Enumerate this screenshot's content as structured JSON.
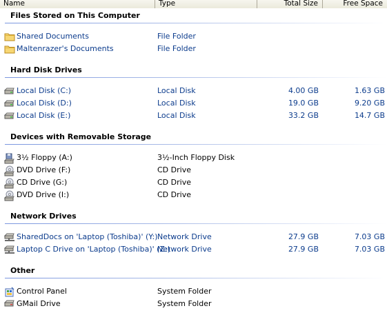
{
  "columns": {
    "name": "Name",
    "type": "Type",
    "total_size": "Total Size",
    "free_space": "Free Space"
  },
  "groups": {
    "files_stored": "Files Stored on This Computer",
    "hard_disks": "Hard Disk Drives",
    "removable": "Devices with Removable Storage",
    "network": "Network Drives",
    "other": "Other"
  },
  "files_stored": [
    {
      "name": "Shared Documents",
      "type": "File Folder",
      "icon": "folder-icon"
    },
    {
      "name": "Maltenrazer's Documents",
      "type": "File Folder",
      "icon": "folder-icon"
    }
  ],
  "hard_disks": [
    {
      "name": "Local Disk (C:)",
      "type": "Local Disk",
      "total": "4.00 GB",
      "free": "1.63 GB",
      "icon": "hard-disk-icon"
    },
    {
      "name": "Local Disk (D:)",
      "type": "Local Disk",
      "total": "19.0 GB",
      "free": "9.20 GB",
      "icon": "hard-disk-icon"
    },
    {
      "name": "Local Disk (E:)",
      "type": "Local Disk",
      "total": "33.2 GB",
      "free": "14.7 GB",
      "icon": "hard-disk-icon"
    }
  ],
  "removable": [
    {
      "name": "3½ Floppy (A:)",
      "type": "3½-Inch Floppy Disk",
      "icon": "floppy-drive-icon"
    },
    {
      "name": "DVD Drive (F:)",
      "type": "CD Drive",
      "icon": "dvd-drive-icon"
    },
    {
      "name": "CD Drive (G:)",
      "type": "CD Drive",
      "icon": "cd-drive-icon"
    },
    {
      "name": "DVD Drive (I:)",
      "type": "CD Drive",
      "icon": "dvd-drive-icon"
    }
  ],
  "network": [
    {
      "name": "SharedDocs on 'Laptop (Toshiba)' (Y:)",
      "type": "Network Drive",
      "total": "27.9 GB",
      "free": "7.03 GB",
      "icon": "network-drive-icon"
    },
    {
      "name": "Laptop C Drive on 'Laptop (Toshiba)' (Z:)",
      "type": "Network Drive",
      "total": "27.9 GB",
      "free": "7.03 GB",
      "icon": "network-drive-icon"
    }
  ],
  "other": [
    {
      "name": "Control Panel",
      "type": "System Folder",
      "icon": "control-panel-icon"
    },
    {
      "name": "GMail Drive",
      "type": "System Folder",
      "icon": "gmail-drive-icon"
    }
  ]
}
